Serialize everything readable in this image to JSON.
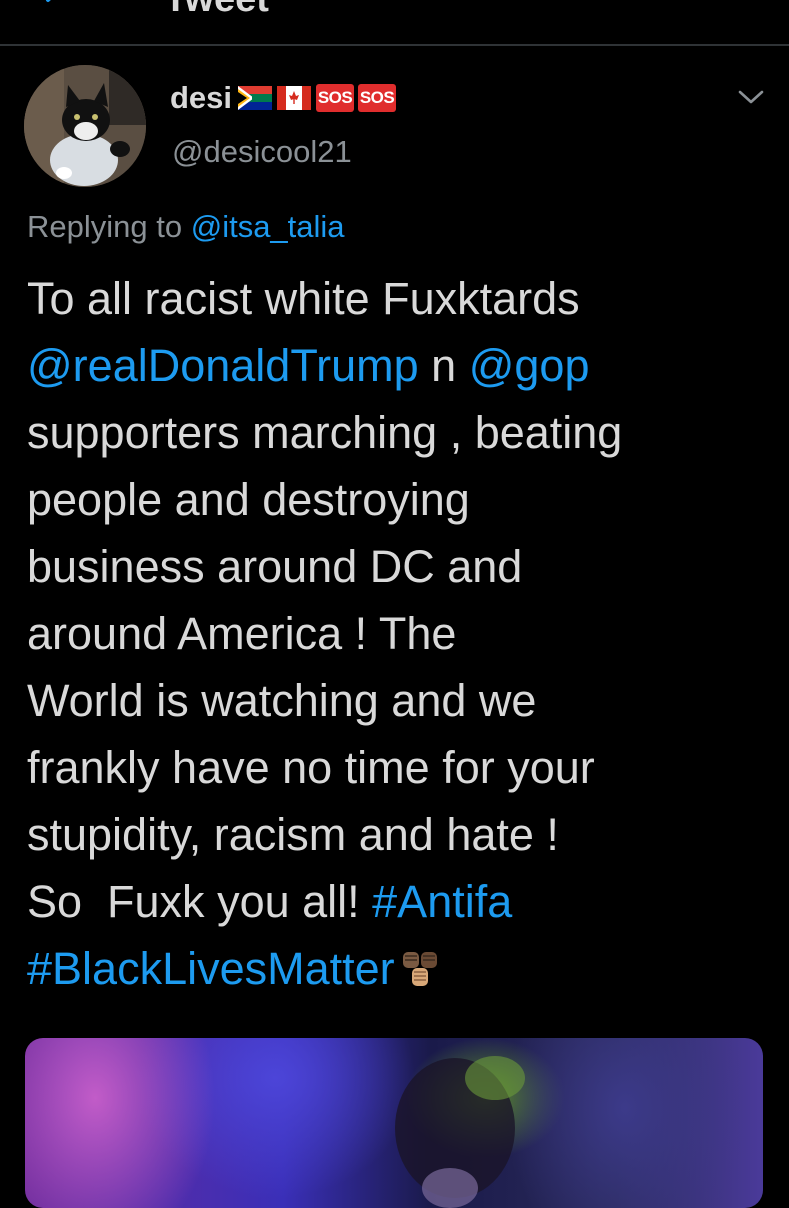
{
  "topbar": {
    "title": "Tweet"
  },
  "tweet": {
    "author": {
      "display_name": "desi",
      "badges": [
        "SOS",
        "SOS"
      ],
      "handle": "@desicool21"
    },
    "replying_prefix": "Replying to ",
    "replying_to": "@itsa_talia",
    "text_lines": [
      [
        {
          "t": "To all racist white Fuxktards"
        }
      ],
      [
        {
          "t": "@realDonaldTrump",
          "link": true
        },
        {
          "t": " n "
        },
        {
          "t": "@gop",
          "link": true
        }
      ],
      [
        {
          "t": "supporters marching , beating"
        }
      ],
      [
        {
          "t": "people and destroying"
        }
      ],
      [
        {
          "t": "business around DC and"
        }
      ],
      [
        {
          "t": "around America ! The"
        }
      ],
      [
        {
          "t": "World is watching and we"
        }
      ],
      [
        {
          "t": "frankly have no time for your"
        }
      ],
      [
        {
          "t": "stupidity, racism and hate !"
        }
      ],
      [
        {
          "t": "So  Fuxk you all! "
        },
        {
          "t": "#Antifa",
          "link": true
        }
      ],
      [
        {
          "t": "#BlackLivesMatter",
          "link": true
        }
      ]
    ]
  },
  "colors": {
    "background": "#000000",
    "text": "#d9d9d9",
    "secondary_text": "#8b9196",
    "link": "#1d9bf0",
    "badge": "#e02d2d"
  },
  "icons": {
    "back": "arrow-left-icon",
    "more": "chevron-down-icon",
    "flags": [
      "south-africa-flag-icon",
      "canada-flag-icon"
    ],
    "emoji": "raised-fists-icon"
  }
}
